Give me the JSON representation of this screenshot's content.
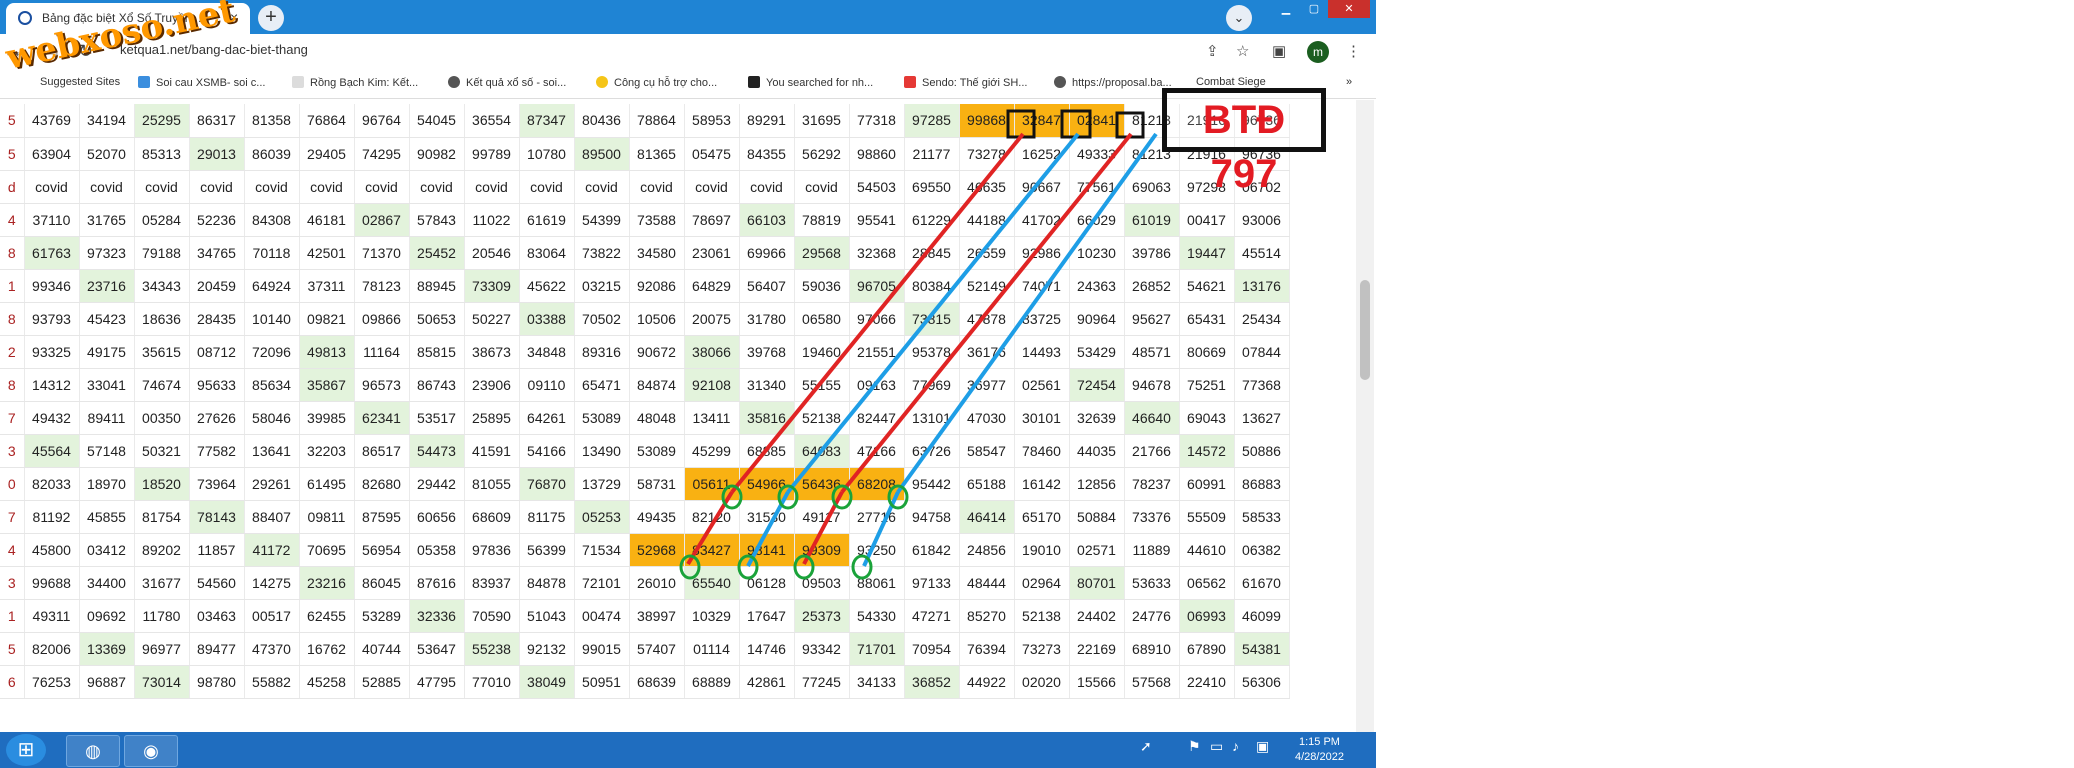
{
  "browser": {
    "tab_title": "Bảng đặc biệt Xổ Số Truyền...",
    "tab_close": "×",
    "new_tab": "+",
    "url": "ketqua1.net/bang-dac-biet-thang",
    "profile_initial": "m",
    "bookmarks": [
      "Suggested Sites",
      "Soi cau XSMB- soi c...",
      "Rồng Bạch Kim: Kết...",
      "Kết quả xổ số - soi...",
      "Công cụ hỗ trợ cho...",
      "You searched for nh...",
      "Sendo: Thế giới SH...",
      "https://proposal.ba...",
      "Combat Siege"
    ]
  },
  "watermark": "webxoso.net",
  "annotation": "BTĐ 797",
  "table": {
    "rows": [
      [
        "5",
        "43769",
        "34194",
        "25295",
        "86317",
        "81358",
        "76864",
        "96764",
        "54045",
        "36554",
        "87347",
        "80436",
        "78864",
        "58953",
        "89291",
        "31695",
        "77318",
        "97285",
        "99868",
        "32847",
        "02841",
        "81213",
        "21916",
        "96736"
      ],
      [
        "5",
        "63904",
        "52070",
        "85313",
        "29013",
        "86039",
        "29405",
        "74295",
        "90982",
        "99789",
        "10780",
        "89500",
        "81365",
        "05475",
        "84355",
        "56292",
        "98860",
        "21177",
        "73278",
        "16252",
        "49333",
        "81213",
        "21916",
        "96736"
      ],
      [
        "d",
        "covid",
        "covid",
        "covid",
        "covid",
        "covid",
        "covid",
        "covid",
        "covid",
        "covid",
        "covid",
        "covid",
        "covid",
        "covid",
        "covid",
        "covid",
        "54503",
        "69550",
        "46635",
        "90667",
        "77561",
        "69063",
        "97298",
        "06702"
      ],
      [
        "4",
        "37110",
        "31765",
        "05284",
        "52236",
        "84308",
        "46181",
        "02867",
        "57843",
        "11022",
        "61619",
        "54399",
        "73588",
        "78697",
        "66103",
        "78819",
        "95541",
        "61229",
        "44188",
        "41702",
        "66029",
        "61019",
        "00417",
        "93006"
      ],
      [
        "8",
        "61763",
        "97323",
        "79188",
        "34765",
        "70118",
        "42501",
        "71370",
        "25452",
        "20546",
        "83064",
        "73822",
        "34580",
        "23061",
        "69966",
        "29568",
        "32368",
        "28845",
        "26559",
        "92986",
        "10230",
        "39786",
        "19447",
        "45514"
      ],
      [
        "1",
        "99346",
        "23716",
        "34343",
        "20459",
        "64924",
        "37311",
        "78123",
        "88945",
        "73309",
        "45622",
        "03215",
        "92086",
        "64829",
        "56407",
        "59036",
        "96705",
        "80384",
        "52149",
        "74071",
        "24363",
        "26852",
        "54621",
        "13176"
      ],
      [
        "8",
        "93793",
        "45423",
        "18636",
        "28435",
        "10140",
        "09821",
        "09866",
        "50653",
        "50227",
        "03388",
        "70502",
        "10506",
        "20075",
        "31780",
        "06580",
        "97066",
        "73815",
        "47878",
        "83725",
        "90964",
        "95627",
        "65431",
        "25434"
      ],
      [
        "2",
        "93325",
        "49175",
        "35615",
        "08712",
        "72096",
        "49813",
        "11164",
        "85815",
        "38673",
        "34848",
        "89316",
        "90672",
        "38066",
        "39768",
        "19460",
        "21551",
        "95378",
        "36176",
        "14493",
        "53429",
        "48571",
        "80669",
        "07844"
      ],
      [
        "8",
        "14312",
        "33041",
        "74674",
        "95633",
        "85634",
        "35867",
        "96573",
        "86743",
        "23906",
        "09110",
        "65471",
        "84874",
        "92108",
        "31340",
        "55155",
        "09163",
        "77969",
        "36977",
        "02561",
        "72454",
        "94678",
        "75251",
        "77368"
      ],
      [
        "7",
        "49432",
        "89411",
        "00350",
        "27626",
        "58046",
        "39985",
        "62341",
        "53517",
        "25895",
        "64261",
        "53089",
        "48048",
        "13411",
        "35816",
        "52138",
        "82447",
        "13101",
        "47030",
        "30101",
        "32639",
        "46640",
        "69043",
        "13627"
      ],
      [
        "3",
        "45564",
        "57148",
        "50321",
        "77582",
        "13641",
        "32203",
        "86517",
        "54473",
        "41591",
        "54166",
        "13490",
        "53089",
        "45299",
        "68885",
        "64083",
        "47166",
        "63726",
        "58547",
        "78460",
        "44035",
        "21766",
        "14572",
        "50886"
      ],
      [
        "0",
        "82033",
        "18970",
        "18520",
        "73964",
        "29261",
        "61495",
        "82680",
        "29442",
        "81055",
        "76870",
        "13729",
        "58731",
        "05611",
        "54966",
        "56436",
        "68208",
        "95442",
        "65188",
        "16142",
        "12856",
        "78237",
        "60991",
        "86883"
      ],
      [
        "7",
        "81192",
        "45855",
        "81754",
        "78143",
        "88407",
        "09811",
        "87595",
        "60656",
        "68609",
        "81175",
        "05253",
        "49435",
        "82120",
        "31530",
        "49117",
        "27716",
        "94758",
        "46414",
        "65170",
        "50884",
        "73376",
        "55509",
        "58533"
      ],
      [
        "4",
        "45800",
        "03412",
        "89202",
        "11857",
        "41172",
        "70695",
        "56954",
        "05358",
        "97836",
        "56399",
        "71534",
        "52968",
        "83427",
        "98141",
        "99309",
        "93250",
        "61842",
        "24856",
        "19010",
        "02571",
        "11889",
        "44610",
        "06382"
      ],
      [
        "3",
        "99688",
        "34400",
        "31677",
        "54560",
        "14275",
        "23216",
        "86045",
        "87616",
        "83937",
        "84878",
        "72101",
        "26010",
        "65540",
        "06128",
        "09503",
        "88061",
        "97133",
        "48444",
        "02964",
        "80701",
        "53633",
        "06562",
        "61670"
      ],
      [
        "1",
        "49311",
        "09692",
        "11780",
        "03463",
        "00517",
        "62455",
        "53289",
        "32336",
        "70590",
        "51043",
        "00474",
        "38997",
        "10329",
        "17647",
        "25373",
        "54330",
        "47271",
        "85270",
        "52138",
        "24402",
        "24776",
        "06993",
        "46099"
      ],
      [
        "5",
        "82006",
        "13369",
        "96977",
        "89477",
        "47370",
        "16762",
        "40744",
        "53647",
        "55238",
        "92132",
        "99015",
        "57407",
        "01114",
        "14746",
        "93342",
        "71701",
        "70954",
        "76394",
        "73273",
        "22169",
        "68910",
        "67890",
        "54381"
      ],
      [
        "6",
        "76253",
        "96887",
        "73014",
        "98780",
        "55882",
        "45258",
        "52885",
        "47795",
        "77010",
        "38049",
        "50951",
        "68639",
        "68889",
        "42861",
        "77245",
        "34133",
        "36852",
        "44922",
        "02020",
        "15566",
        "57568",
        "22410",
        "56306"
      ]
    ]
  },
  "taskbar": {
    "time": "1:15 PM",
    "date": "4/28/2022"
  }
}
